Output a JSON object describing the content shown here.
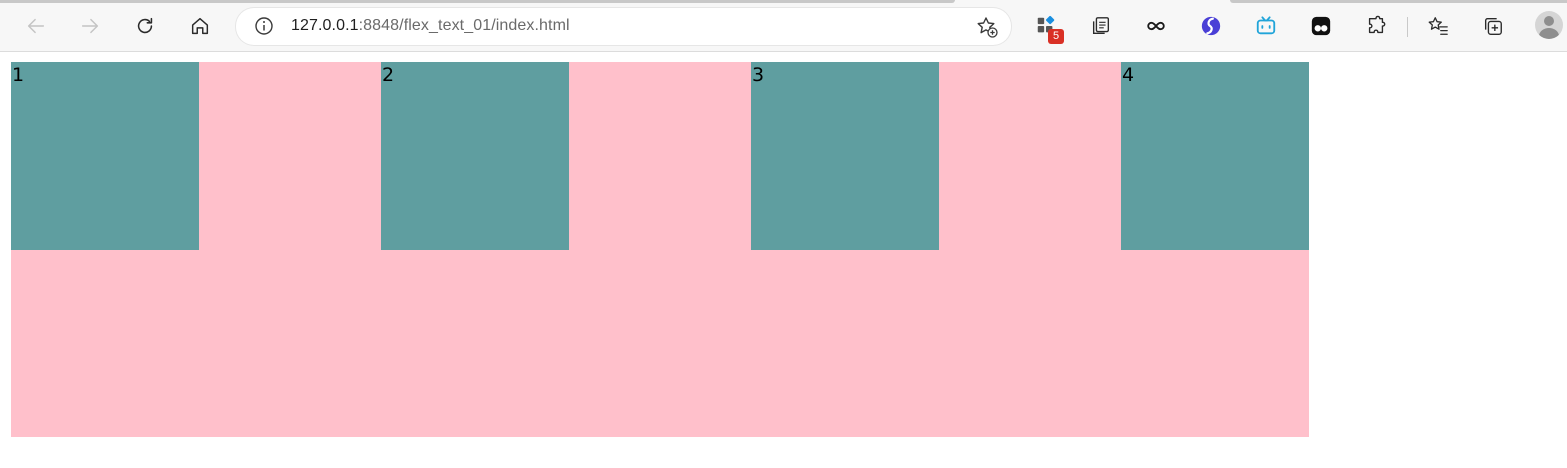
{
  "browser": {
    "url_host": "127.0.0.1",
    "url_rest": ":8848/flex_text_01/index.html",
    "extension_badge": "5",
    "toolbar_icons": [
      "back-icon",
      "forward-icon",
      "refresh-icon",
      "home-icon",
      "info-icon",
      "add-favorite-icon",
      "extension-grid-icon",
      "collections-icon",
      "infinity-icon",
      "swirl-extension-icon",
      "bilibili-icon",
      "tampermonkey-icon",
      "extensions-puzzle-icon",
      "favorites-icon",
      "tab-actions-icon",
      "profile-avatar"
    ]
  },
  "page": {
    "container_color": "#ffc0cb",
    "item_color": "#5f9ea0",
    "items": [
      {
        "label": "1"
      },
      {
        "label": "2"
      },
      {
        "label": "3"
      },
      {
        "label": "4"
      }
    ]
  }
}
